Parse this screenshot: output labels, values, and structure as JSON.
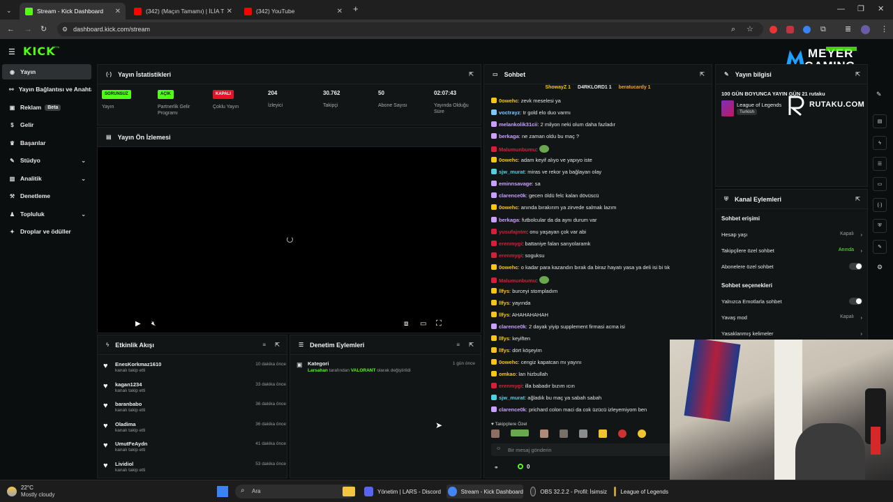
{
  "browser": {
    "tabs": [
      {
        "title": "Stream - Kick Dashboard",
        "active": true
      },
      {
        "title": "(342) (Maçın Tamamı) | İLİA TOP",
        "active": false
      },
      {
        "title": "(342) YouTube",
        "active": false
      }
    ],
    "url": "dashboard.kick.com/stream"
  },
  "header": {
    "logo": "KICK",
    "logo_tag": "BETA"
  },
  "overlay": {
    "brand_top": "MEYER",
    "brand_bottom": "GAMING",
    "sponsor": "RUTAKU.COM"
  },
  "sidebar": {
    "items": [
      {
        "label": "Yayın",
        "icon": "camera-icon",
        "active": true
      },
      {
        "label": "Yayın Bağlantısı ve Anahtarı",
        "icon": "link-icon"
      },
      {
        "label": "Reklam",
        "icon": "ad-icon",
        "badge": "Beta"
      },
      {
        "label": "Gelir",
        "icon": "dollar-icon"
      },
      {
        "label": "Başarılar",
        "icon": "trophy-icon"
      },
      {
        "label": "Stüdyo",
        "icon": "palette-icon",
        "chevron": true
      },
      {
        "label": "Analitik",
        "icon": "chart-icon",
        "chevron": true
      },
      {
        "label": "Denetleme",
        "icon": "hammer-icon"
      },
      {
        "label": "Topluluk",
        "icon": "users-icon",
        "chevron": true
      },
      {
        "label": "Droplar ve ödüller",
        "icon": "gift-icon"
      }
    ]
  },
  "stats": {
    "title": "Yayın İstatistikleri",
    "items": [
      {
        "pill": "SORUNSUZ",
        "pill_color": "#53fc18",
        "label": "Yayın"
      },
      {
        "pill": "AÇIK",
        "pill_color": "#53fc18",
        "label": "Partnerlik Gelir Programı"
      },
      {
        "pill": "KAPALI",
        "pill_color": "#e3122a",
        "label": "Çoklu Yayın"
      },
      {
        "value": "204",
        "label": "İzleyici"
      },
      {
        "value": "30.762",
        "label": "Takipçi"
      },
      {
        "value": "50",
        "label": "Abone Sayısı"
      },
      {
        "value": "02:07:43",
        "label": "Yayında Olduğu Süre"
      }
    ]
  },
  "preview": {
    "title": "Yayın Ön İzlemesi"
  },
  "events": {
    "title": "Etkinlik Akışı",
    "items": [
      {
        "name": "EnesKorkmaz1610",
        "sub": "kanalı takip etti",
        "time": "10 dakika önce"
      },
      {
        "name": "kagan1234",
        "sub": "kanalı takip etti",
        "time": "33 dakika önce"
      },
      {
        "name": "baranbabo",
        "sub": "kanalı takip etti",
        "time": "36 dakika önce"
      },
      {
        "name": "Oladima",
        "sub": "kanalı takip etti",
        "time": "36 dakika önce"
      },
      {
        "name": "UmutFeAydn",
        "sub": "kanalı takip etti",
        "time": "41 dakika önce"
      },
      {
        "name": "Lividiol",
        "sub": "kanalı takip etti",
        "time": "53 dakika önce"
      }
    ]
  },
  "moderation": {
    "title": "Denetim Eylemleri",
    "items": [
      {
        "title": "Kategori",
        "time": "1 gün önce",
        "user": "Larsahan",
        "mid": " tarafından ",
        "value": "VALORANT",
        "end": " olarak değiştirildi"
      }
    ]
  },
  "chat": {
    "title": "Sohbet",
    "top_gifters": [
      "ShowayZ 1",
      "D4RKLORD1 1",
      "beratucardy 1"
    ],
    "messages": [
      {
        "user": "0owehc",
        "color": "#f5c518",
        "text": "zevk meselesi ya"
      },
      {
        "user": "voctrayz",
        "color": "#7ec7ff",
        "text": "tr gold elo duo varmı"
      },
      {
        "user": "melankolik31cii",
        "color": "#c9a0ff",
        "text": "2 milyon neki olum daha fazladır"
      },
      {
        "user": "berkaga",
        "color": "#c9a0ff",
        "text": "ne zaman oldu bu maç ?"
      },
      {
        "user": "Malumunbumu",
        "color": "#d6203a",
        "text": ""
      },
      {
        "user": "0owehc",
        "color": "#f5c518",
        "text": "adam keyif alıyo ve yapıyo iste"
      },
      {
        "user": "sjw_murat",
        "color": "#4fd1e0",
        "text": "miras ve rekor ya bağlayan olay"
      },
      {
        "user": "eminnsavage",
        "color": "#c9a0ff",
        "text": "sa"
      },
      {
        "user": "clarence0k",
        "color": "#c9a0ff",
        "text": "gecen öldü felc kalan dövüscü"
      },
      {
        "user": "0owehc",
        "color": "#f5c518",
        "text": "anında bırakırım ya zirvede salmak lazım"
      },
      {
        "user": "berkaga",
        "color": "#c9a0ff",
        "text": "futbolcular da da aynı durum var"
      },
      {
        "user": "yusufajntm",
        "color": "#d6203a",
        "text": "onu yaşayan çok var abi"
      },
      {
        "user": "erenmygi",
        "color": "#d6203a",
        "text": "battaniye falan sarıyolaramk"
      },
      {
        "user": "erenmygi",
        "color": "#d6203a",
        "text": "soguksu"
      },
      {
        "user": "0owehc",
        "color": "#f5c518",
        "text": "o kadar para kazandın bırak da biraz hayatı yasa ya deli isi bi tık"
      },
      {
        "user": "Malumunbumu",
        "color": "#d6203a",
        "text": ""
      },
      {
        "user": "llfys",
        "color": "#f5c518",
        "text": "burceyi stompladım"
      },
      {
        "user": "llfys",
        "color": "#f5c518",
        "text": "yayında"
      },
      {
        "user": "llfys",
        "color": "#f5c518",
        "text": "AHAHAHAHAH"
      },
      {
        "user": "clarence0k",
        "color": "#c9a0ff",
        "text": "2 dayak yiyip supplement firmasi acma isi"
      },
      {
        "user": "llfys",
        "color": "#f5c518",
        "text": "keyiften"
      },
      {
        "user": "llfys",
        "color": "#f5c518",
        "text": "dört köşeyim"
      },
      {
        "user": "0owehc",
        "color": "#f5c518",
        "text": "cengiz kapatcan mı yayını"
      },
      {
        "user": "omkao",
        "color": "#f5c518",
        "text": "lan hizbullah"
      },
      {
        "user": "erenmygi",
        "color": "#d6203a",
        "text": "illa babadır bızım ıcın"
      },
      {
        "user": "sjw_murat",
        "color": "#4fd1e0",
        "text": "ağladık bu maç ya sabah sabah"
      },
      {
        "user": "clarence0k",
        "color": "#c9a0ff",
        "text": "prichard colon maci da cok üzücü izleyemiyom ben"
      }
    ],
    "followers_only": "Takipçilere Özel",
    "input_placeholder": "Bir mesaj gönderin",
    "points": "0"
  },
  "stream_info": {
    "title": "Yayın bilgisi",
    "stream_title": "100 GÜN BOYUNCA YAYIN GÜN 21 rutaku",
    "category": "League of Legends",
    "tag": "Turkish"
  },
  "channel_actions": {
    "title": "Kanal Eylemleri",
    "section1": "Sohbet erişimi",
    "rows1": [
      {
        "label": "Hesap yaşı",
        "value": "Kapalı",
        "kind": "arrow"
      },
      {
        "label": "Takipçilere özel sohbet",
        "value": "Anında",
        "kind": "arrow",
        "value_color": "#53fc18"
      },
      {
        "label": "Abonelere özel sohbet",
        "value": "",
        "kind": "toggle"
      }
    ],
    "section2": "Sohbet seçenekleri",
    "rows2": [
      {
        "label": "Yalnızca Emotlarla sohbet",
        "value": "",
        "kind": "toggle"
      },
      {
        "label": "Yavaş mod",
        "value": "Kapalı",
        "kind": "arrow"
      },
      {
        "label": "Yasaklanmış kelimeler",
        "value": "",
        "kind": "arrow"
      }
    ]
  },
  "taskbar": {
    "weather_temp": "22°C",
    "weather_desc": "Mostly cloudy",
    "search_placeholder": "Ara",
    "apps": [
      {
        "label": "Yönetim | LARS - Discord",
        "color": "#5865f2"
      },
      {
        "label": "Stream - Kick Dashboard",
        "color": "#4285f4"
      },
      {
        "label": "OBS 32.2.2 - Profil: İsimsiz",
        "color": "#302e31"
      },
      {
        "label": "League of Legends",
        "color": "#c89b3c"
      }
    ]
  },
  "colors": {
    "accent": "#53fc18",
    "danger": "#e3122a",
    "panel": "#121516",
    "bg": "#0b0e0f"
  }
}
